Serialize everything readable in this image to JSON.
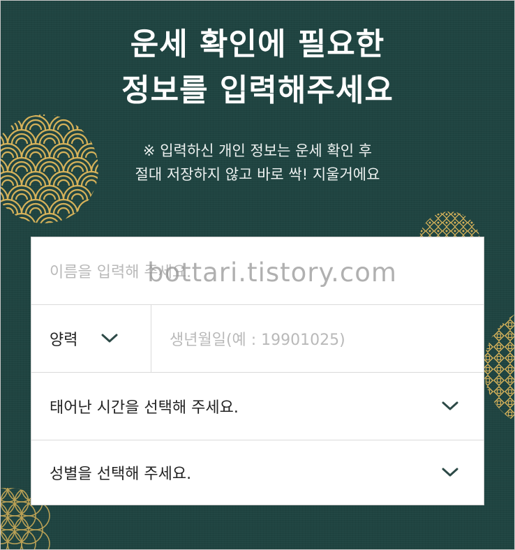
{
  "header": {
    "title_line1": "운세 확인에 필요한",
    "title_line2": "정보를 입력해주세요",
    "notice_line1": "※ 입력하신 개인 정보는 운세 확인 후",
    "notice_line2": "절대 저장하지 않고 바로 싹! 지울거에요"
  },
  "form": {
    "name": {
      "placeholder": "이름을 입력해 주세요."
    },
    "calendar_type": {
      "selected": "양력"
    },
    "birthdate": {
      "placeholder": "생년월일(예 : 19901025)"
    },
    "birth_time": {
      "label": "태어난 시간을 선택해 주세요."
    },
    "gender": {
      "label": "성별을 선택해 주세요."
    }
  },
  "watermark": "bottari.tistory.com",
  "colors": {
    "background": "#1f4441",
    "pattern_gold": "#d6b25a",
    "chevron": "#2d4a47"
  }
}
